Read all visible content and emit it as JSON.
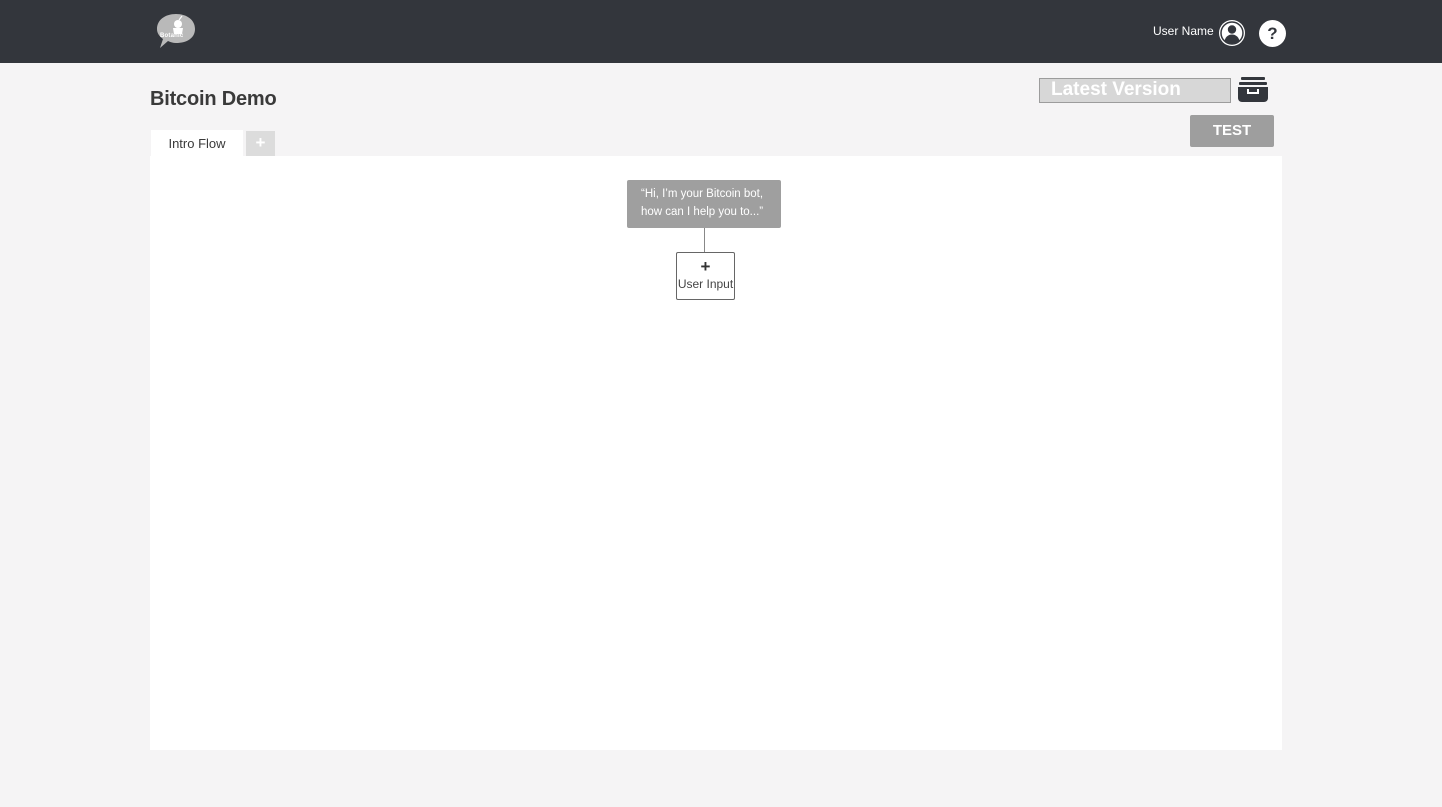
{
  "header": {
    "logo": {
      "icon": "speech-bubble-bot-icon",
      "text": "Botanic"
    },
    "user_name": "User Name",
    "user_icon": "user-avatar-icon",
    "help_label": "?",
    "help_icon": "help-icon"
  },
  "page": {
    "title": "Bitcoin Demo",
    "version_label": "Latest Version",
    "archive_icon": "archive-box-icon",
    "test_label": "TEST"
  },
  "tabs": [
    {
      "label": "Intro Flow",
      "active": true
    },
    {
      "label": "+",
      "active": false
    }
  ],
  "flow": {
    "bot_message": {
      "line1": "“Hi, I’m your Bitcoin bot,",
      "line2": "how can I help you to...”"
    },
    "user_input": {
      "plus": "+",
      "label": "User Input"
    }
  },
  "colors": {
    "topbar": "#33363c",
    "background": "#f5f4f5",
    "node_grey": "#9f9f9f",
    "test_button": "#9e9e9e"
  }
}
